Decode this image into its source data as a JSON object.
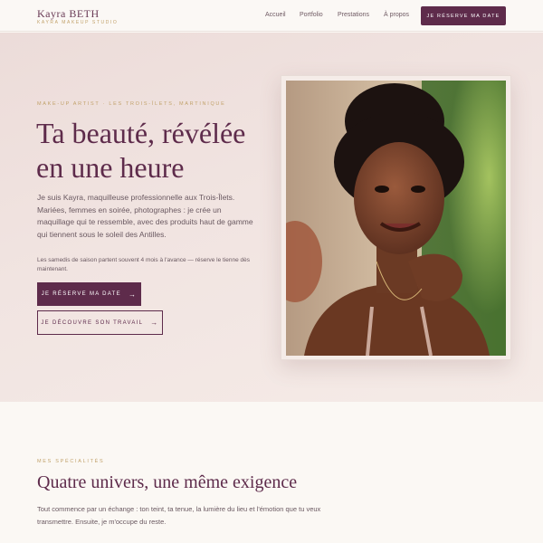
{
  "header": {
    "logo_name": "Kayra BETH",
    "logo_tagline": "KAYRA MAKEUP STUDIO",
    "nav": [
      "Accueil",
      "Portfolio",
      "Prestations",
      "À propos"
    ],
    "cta": "JE RÉSERVE MA DATE"
  },
  "hero": {
    "eyebrow": "MAKE-UP ARTIST · LES TROIS-ÎLETS, MARTINIQUE",
    "title": "Ta beauté, révélée en une heure",
    "text": "Je suis Kayra, maquilleuse professionnelle aux Trois-Îlets. Mariées, femmes en soirée, photographes : je crée un maquillage qui te ressemble, avec des produits haut de gamme qui tiennent sous le soleil des Antilles.",
    "note": "Les samedis de saison partent souvent 4 mois à l'avance — réserve le tienne dès maintenant.",
    "primary_button": "JE RÉSERVE MA DATE",
    "secondary_button": "JE DÉCOUVRE SON TRAVAIL",
    "arrow": "→"
  },
  "specialties": {
    "eyebrow": "MES SPÉCIALITÉS",
    "title": "Quatre univers, une même exigence",
    "text": "Tout commence par un échange : ton teint, ta tenue, la lumière du lieu et l'émotion que tu veux transmettre. Ensuite, je m'occupe du reste."
  },
  "colors": {
    "brand": "#5e2b4b",
    "accent_gold": "#c2a26b",
    "hero_bg": "#f1e4e1"
  }
}
